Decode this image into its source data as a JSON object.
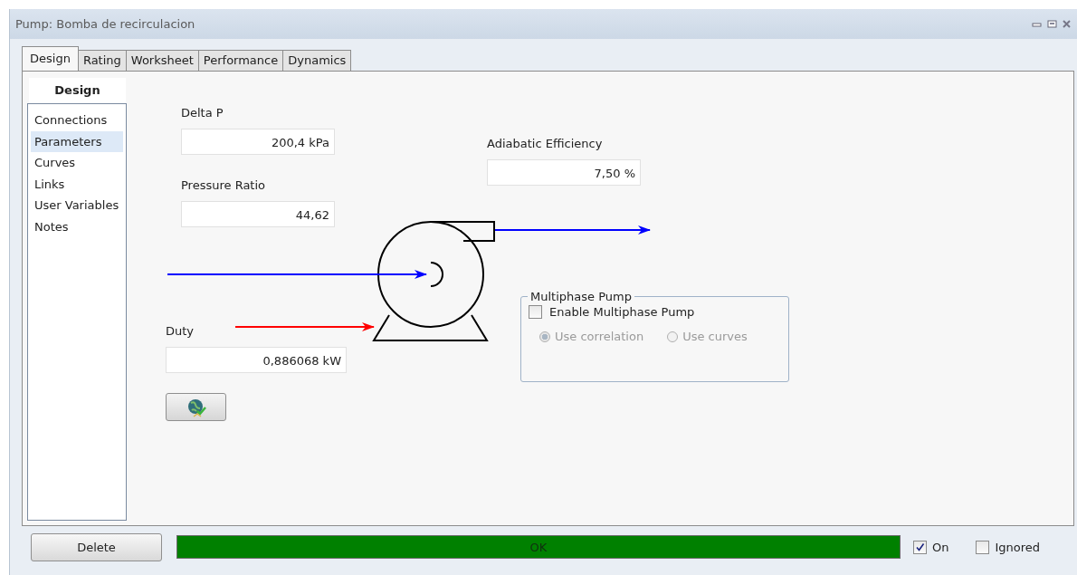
{
  "window": {
    "title": "Pump: Bomba de recirculacion"
  },
  "tabs": [
    {
      "label": "Design",
      "selected": true
    },
    {
      "label": "Rating",
      "selected": false
    },
    {
      "label": "Worksheet",
      "selected": false
    },
    {
      "label": "Performance",
      "selected": false
    },
    {
      "label": "Dynamics",
      "selected": false
    }
  ],
  "sidebar": {
    "header": "Design",
    "items": [
      {
        "label": "Connections",
        "selected": false
      },
      {
        "label": "Parameters",
        "selected": true
      },
      {
        "label": "Curves",
        "selected": false
      },
      {
        "label": "Links",
        "selected": false
      },
      {
        "label": "User Variables",
        "selected": false
      },
      {
        "label": "Notes",
        "selected": false
      }
    ]
  },
  "parameters": {
    "delta_p": {
      "label": "Delta P",
      "value": "200,4 kPa"
    },
    "pressure_ratio": {
      "label": "Pressure Ratio",
      "value": "44,62"
    },
    "adiabatic_efficiency": {
      "label": "Adiabatic Efficiency",
      "value": "7,50 %"
    },
    "duty": {
      "label": "Duty",
      "value": "0,886068 kW"
    }
  },
  "multiphase": {
    "title": "Multiphase Pump",
    "enable": {
      "label": "Enable Multiphase Pump",
      "checked": false
    },
    "options": [
      {
        "label": "Use correlation",
        "selected": true,
        "disabled": true
      },
      {
        "label": "Use curves",
        "selected": false,
        "disabled": true
      }
    ]
  },
  "footer": {
    "delete_button": "Delete",
    "status": {
      "text": "OK",
      "color": "#008000"
    },
    "toggles": [
      {
        "label": "On",
        "checked": true
      },
      {
        "label": "Ignored",
        "checked": false
      }
    ]
  }
}
